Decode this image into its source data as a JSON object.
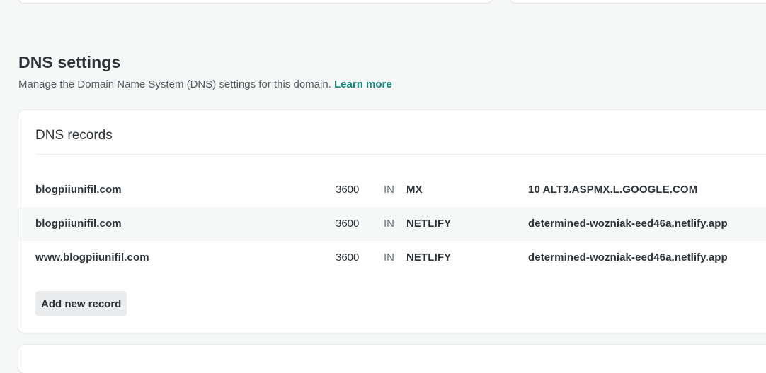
{
  "dns_section": {
    "title": "DNS settings",
    "description": "Manage the Domain Name System (DNS) settings for this domain.",
    "learn_more": "Learn more"
  },
  "records": {
    "title": "DNS records",
    "rows": [
      {
        "name": "blogpiiunifil.com",
        "ttl": "3600",
        "class": "IN",
        "type": "MX",
        "value": "10 ALT3.ASPMX.L.GOOGLE.COM"
      },
      {
        "name": "blogpiiunifil.com",
        "ttl": "3600",
        "class": "IN",
        "type": "NETLIFY",
        "value": "determined-wozniak-eed46a.netlify.app"
      },
      {
        "name": "www.blogpiiunifil.com",
        "ttl": "3600",
        "class": "IN",
        "type": "NETLIFY",
        "value": "determined-wozniak-eed46a.netlify.app"
      }
    ],
    "add_button": "Add new record"
  },
  "colors": {
    "accent_link": "#15847d",
    "page_background": "#f6f8f8",
    "button_background": "#e9ebed"
  }
}
